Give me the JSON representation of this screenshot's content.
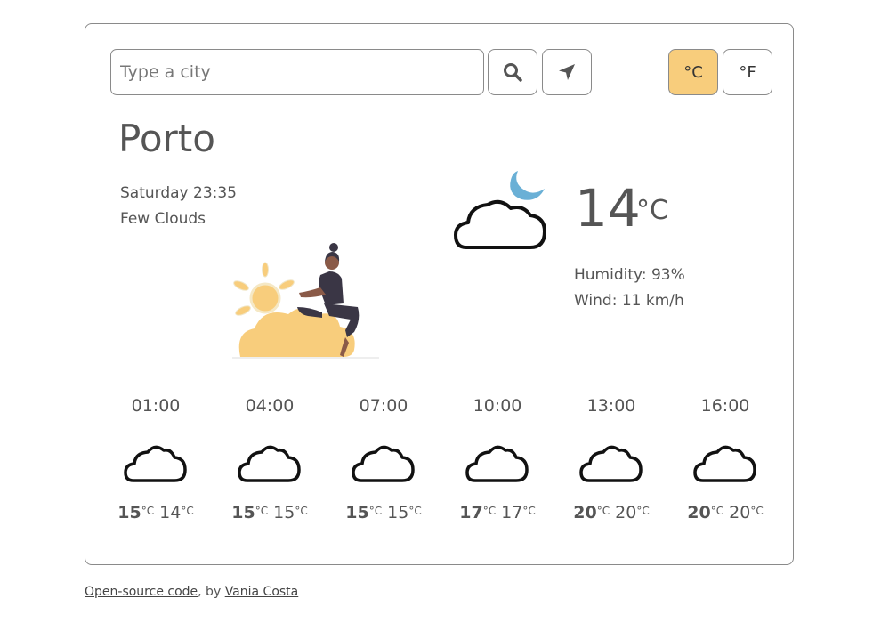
{
  "search": {
    "placeholder": "Type a city"
  },
  "buttons": {
    "celsius_label": "°C",
    "fahrenheit_label": "°F"
  },
  "current": {
    "city": "Porto",
    "datetime": "Saturday 23:35",
    "description": "Few Clouds",
    "temperature": "14",
    "unit": "°C",
    "humidity": "Humidity: 93%",
    "wind": "Wind: 11 km/h",
    "icon": "cloud-moon-icon"
  },
  "forecast": [
    {
      "time": "01:00",
      "max": "15",
      "min": "14",
      "unit": "°C",
      "icon": "cloud-icon"
    },
    {
      "time": "04:00",
      "max": "15",
      "min": "15",
      "unit": "°C",
      "icon": "cloud-icon"
    },
    {
      "time": "07:00",
      "max": "15",
      "min": "15",
      "unit": "°C",
      "icon": "cloud-icon"
    },
    {
      "time": "10:00",
      "max": "17",
      "min": "17",
      "unit": "°C",
      "icon": "cloud-icon"
    },
    {
      "time": "13:00",
      "max": "20",
      "min": "20",
      "unit": "°C",
      "icon": "cloud-icon"
    },
    {
      "time": "16:00",
      "max": "20",
      "min": "20",
      "unit": "°C",
      "icon": "cloud-icon"
    }
  ],
  "footer": {
    "link_text": "Open-source code",
    "by_text": ", by ",
    "author": "Vania Costa"
  },
  "colors": {
    "accent": "#f8cd7c",
    "moon": "#5aaed6",
    "border": "#8a8a8a"
  }
}
